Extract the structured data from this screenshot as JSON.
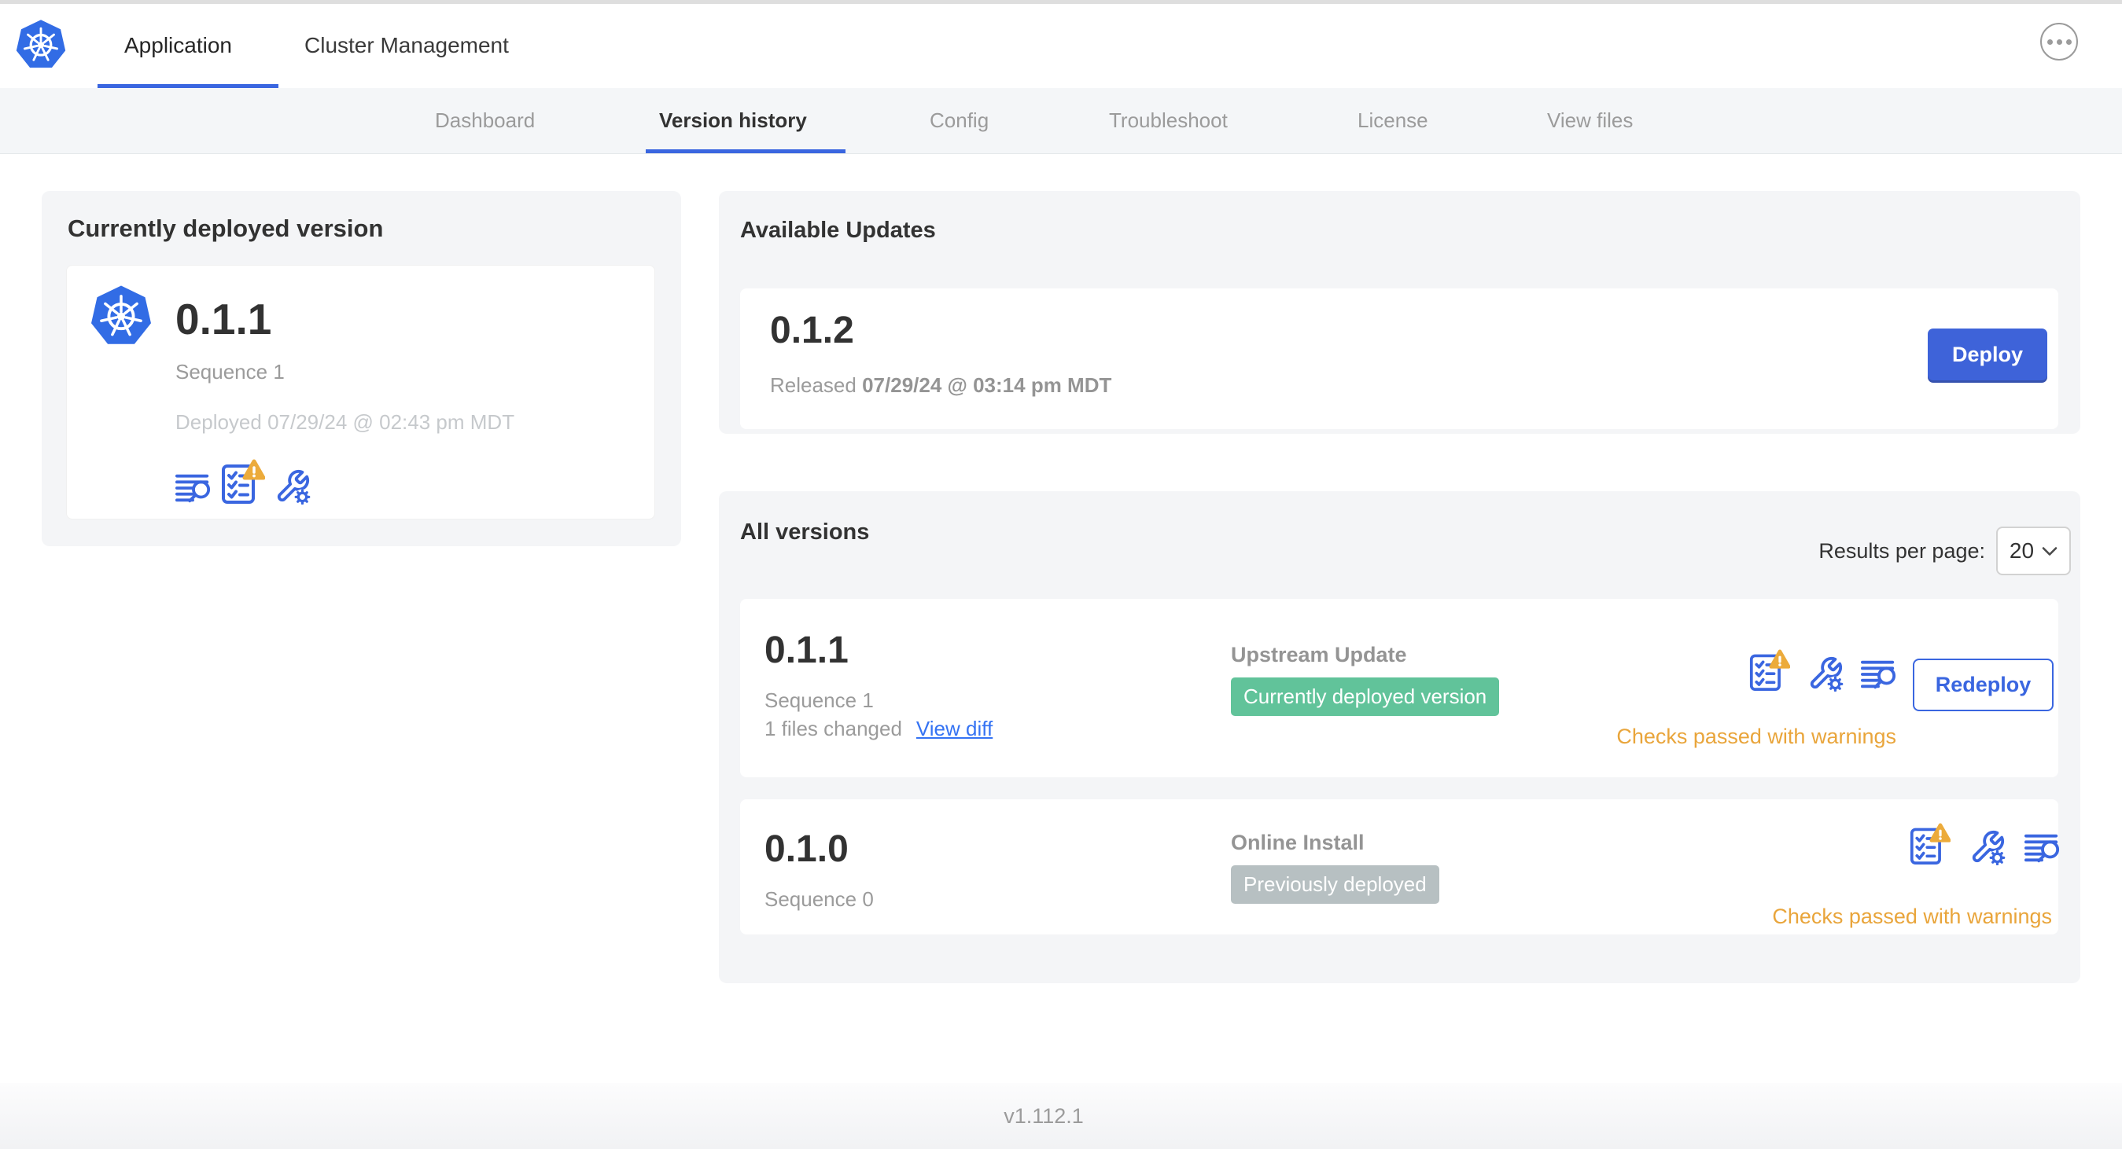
{
  "header": {
    "tabs": [
      {
        "label": "Application",
        "active": true
      },
      {
        "label": "Cluster Management",
        "active": false
      }
    ]
  },
  "subnav": {
    "tabs": [
      {
        "label": "Dashboard",
        "active": false
      },
      {
        "label": "Version history",
        "active": true
      },
      {
        "label": "Config",
        "active": false
      },
      {
        "label": "Troubleshoot",
        "active": false
      },
      {
        "label": "License",
        "active": false
      },
      {
        "label": "View files",
        "active": false
      }
    ]
  },
  "current_version_card": {
    "title": "Currently deployed version",
    "version": "0.1.1",
    "sequence": "Sequence 1",
    "deployed": "Deployed 07/29/24 @ 02:43 pm MDT"
  },
  "available_updates": {
    "title": "Available Updates",
    "version": "0.1.2",
    "released_prefix": "Released",
    "released_date": "07/29/24 @ 03:14 pm MDT",
    "deploy_label": "Deploy"
  },
  "all_versions": {
    "title": "All versions",
    "results_per_page_label": "Results per page:",
    "results_per_page_value": "20",
    "rows": [
      {
        "version": "0.1.1",
        "sequence": "Sequence 1",
        "files_changed": "1 files changed",
        "view_diff_label": "View diff",
        "source": "Upstream Update",
        "badge": "Currently deployed version",
        "badge_color": "#61c39a",
        "checks": "Checks passed with warnings",
        "action_label": "Redeploy"
      },
      {
        "version": "0.1.0",
        "sequence": "Sequence 0",
        "source": "Online Install",
        "badge": "Previously deployed",
        "badge_color": "#b7c0c2",
        "checks": "Checks passed with warnings"
      }
    ]
  },
  "footer": {
    "version": "v1.112.1"
  },
  "icons": {
    "app_logo": "kubernetes-logo",
    "header_more": "ellipsis-icon",
    "version_actions": [
      "view-logs-icon",
      "preflight-checks-icon",
      "edit-config-icon"
    ],
    "warning_overlay": "warning-triangle-icon",
    "select_chevron": "chevron-down-icon"
  },
  "colors": {
    "accent_blue": "#3a66e0",
    "deploy_blue": "#3e63d9",
    "link_blue": "#3573f3",
    "badge_green": "#61c39a",
    "badge_gray": "#b7c0c2",
    "warning_orange": "#e9a53b",
    "k8s_blue": "#326ce5"
  }
}
